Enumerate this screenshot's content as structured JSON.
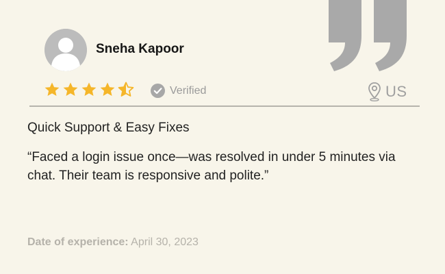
{
  "reviewer": {
    "name": "Sneha Kapoor",
    "avatar_icon": "user-avatar-icon",
    "rating": 4.5,
    "rating_max": 5,
    "verified_label": "Verified",
    "country": "US"
  },
  "review": {
    "title": "Quick Support & Easy Fixes",
    "body": "“Faced a login issue once—was resolved in under 5 minutes via chat. Their team is responsive and polite.”",
    "date_label": "Date of experience:",
    "date_value": "April 30, 2023"
  },
  "colors": {
    "background": "#f8f5ea",
    "star": "#f5b62a",
    "quote_mark": "#a9a9a9",
    "muted_text": "#b5b2aa"
  },
  "icons": {
    "star": "star-icon",
    "verified": "check-circle-icon",
    "location": "map-pin-icon",
    "quote": "quote-mark-icon"
  }
}
